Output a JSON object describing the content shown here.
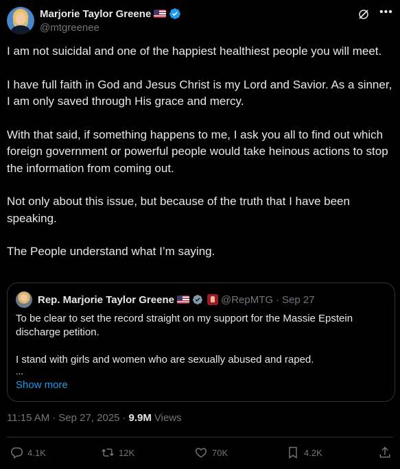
{
  "author": {
    "name": "Marjorie Taylor Greene",
    "handle": "@mtgreenee"
  },
  "body": [
    "I am not suicidal and one of the happiest healthiest people you will meet.",
    "I have full faith in God and Jesus Christ is my Lord and Savior. As a sinner, I am only saved through His grace and mercy.",
    "With that said, if something happens to me, I ask you all to find out which foreign government or powerful people would take heinous actions to stop the information from coming out.",
    "Not only about this issue, but because of the truth that I have been speaking.",
    "The People understand what I’m saying."
  ],
  "quote": {
    "name": "Rep. Marjorie Taylor Greene",
    "handle": "@RepMTG",
    "dot": "·",
    "date": "Sep 27",
    "text": [
      "To be clear to set the record straight on my support for the Massie Epstein discharge petition.",
      "I stand with girls and women who are sexually abused and raped."
    ],
    "ellipsis": "...",
    "show_more": "Show more"
  },
  "meta": {
    "time": "11:15 AM",
    "sep": "·",
    "date": "Sep 27, 2025",
    "sep2": "·",
    "views_count": "9.9M",
    "views_label": "Views"
  },
  "actions": {
    "replies": "4.1K",
    "reposts": "12K",
    "likes": "70K",
    "bookmarks": "4.2K"
  },
  "icons": {
    "verified": "verified-badge-icon",
    "flag": "us-flag-icon",
    "grok": "grok-icon",
    "more": "more-icon",
    "reply": "reply-icon",
    "repost": "repost-icon",
    "like": "like-icon",
    "bookmark": "bookmark-icon",
    "share": "share-icon"
  },
  "colors": {
    "background": "#000000",
    "text": "#e7e9ea",
    "muted": "#71767b",
    "accent": "#1d9bf0",
    "border": "#2f3336"
  }
}
